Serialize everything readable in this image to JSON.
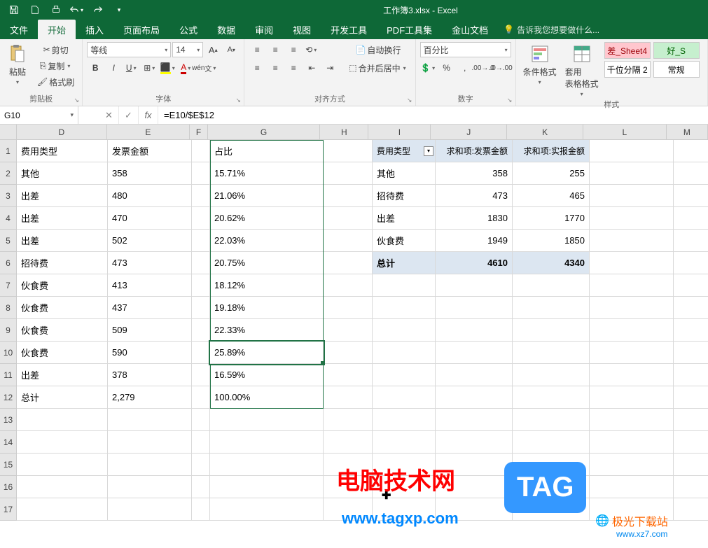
{
  "titlebar": {
    "title": "工作簿3.xlsx - Excel"
  },
  "tabs": {
    "file": "文件",
    "home": "开始",
    "insert": "插入",
    "pagelayout": "页面布局",
    "formulas": "公式",
    "data": "数据",
    "review": "审阅",
    "view": "视图",
    "developer": "开发工具",
    "pdf": "PDF工具集",
    "jinshan": "金山文档",
    "tellme": "告诉我您想要做什么..."
  },
  "ribbon": {
    "clipboard": {
      "paste": "粘贴",
      "cut": "剪切",
      "copy": "复制",
      "format": "格式刷",
      "label": "剪贴板"
    },
    "font": {
      "name": "等线",
      "size": "14",
      "label": "字体"
    },
    "align": {
      "wrap": "自动换行",
      "merge": "合并后居中",
      "label": "对齐方式"
    },
    "number": {
      "format": "百分比",
      "label": "数字"
    },
    "styles": {
      "cond": "条件格式",
      "table": "套用\n表格格式",
      "cellstyle_bad": "差_Sheet4",
      "cellstyle_good": "好_S",
      "cellstyle_thousand": "千位分隔 2",
      "cellstyle_normal": "常规",
      "label": "样式"
    }
  },
  "formulabar": {
    "name": "G10",
    "formula": "=E10/$E$12"
  },
  "sheet": {
    "cols": [
      "D",
      "E",
      "F",
      "G",
      "H",
      "I",
      "J",
      "K",
      "L",
      "M"
    ],
    "headers": {
      "d": "费用类型",
      "e": "发票金额",
      "g": "占比",
      "i": "费用类型",
      "j": "求和项:发票金额",
      "k": "求和项:实报金额"
    },
    "rows": [
      {
        "d": "其他",
        "e": "358",
        "g": "15.71%"
      },
      {
        "d": "出差",
        "e": "480",
        "g": "21.06%"
      },
      {
        "d": "出差",
        "e": "470",
        "g": "20.62%"
      },
      {
        "d": "出差",
        "e": "502",
        "g": "22.03%"
      },
      {
        "d": "招待费",
        "e": "473",
        "g": "20.75%"
      },
      {
        "d": "伙食费",
        "e": "413",
        "g": "18.12%"
      },
      {
        "d": "伙食费",
        "e": "437",
        "g": "19.18%"
      },
      {
        "d": "伙食费",
        "e": "509",
        "g": "22.33%"
      },
      {
        "d": "伙食费",
        "e": "590",
        "g": "25.89%"
      },
      {
        "d": "出差",
        "e": "378",
        "g": "16.59%"
      },
      {
        "d": "总计",
        "e": "2,279",
        "g": "100.00%"
      }
    ],
    "pivot": [
      {
        "i": "其他",
        "j": "358",
        "k": "255"
      },
      {
        "i": "招待费",
        "j": "473",
        "k": "465"
      },
      {
        "i": "出差",
        "j": "1830",
        "k": "1770"
      },
      {
        "i": "伙食费",
        "j": "1949",
        "k": "1850"
      }
    ],
    "pivot_total": {
      "i": "总计",
      "j": "4610",
      "k": "4340"
    }
  },
  "watermark": {
    "line1": "电脑技术网",
    "line2": "www.tagxp.com",
    "tag": "TAG",
    "jiguang": "极光下载站",
    "jiguang_url": "www.xz7.com"
  }
}
